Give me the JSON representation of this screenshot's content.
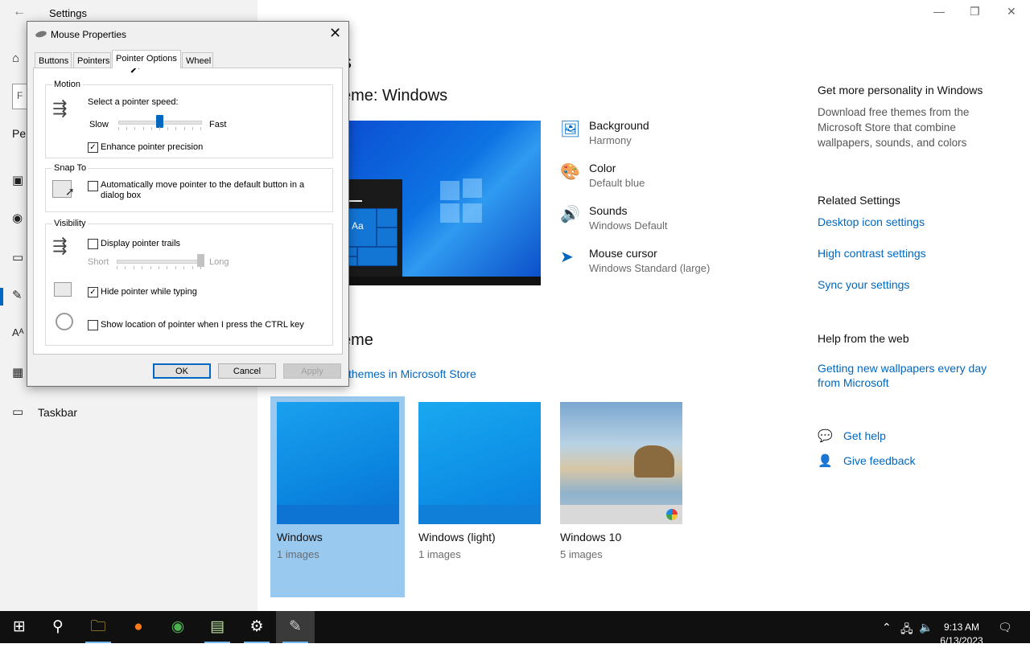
{
  "settings": {
    "title": "Settings",
    "nav": {
      "section_partial": "Per",
      "taskbar_label": "Taskbar",
      "search_partial": "F"
    },
    "main": {
      "heading_partial": "s",
      "current_theme_partial": "eme: Windows",
      "change_theme_partial": "eme",
      "store_link_partial": "themes in Microsoft Store"
    },
    "customize": [
      {
        "label": "Background",
        "sub": "Harmony",
        "icon": "picture-icon"
      },
      {
        "label": "Color",
        "sub": "Default blue",
        "icon": "palette-icon"
      },
      {
        "label": "Sounds",
        "sub": "Windows Default",
        "icon": "speaker-icon"
      },
      {
        "label": "Mouse cursor",
        "sub": "Windows Standard (large)",
        "icon": "cursor-icon"
      }
    ],
    "sidebar": {
      "personality_heading": "Get more personality in Windows",
      "personality_text": "Download free themes from the Microsoft Store that combine wallpapers, sounds, and colors",
      "related_heading": "Related Settings",
      "related_links": [
        "Desktop icon settings",
        "High contrast settings",
        "Sync your settings"
      ],
      "help_heading": "Help from the web",
      "help_link": "Getting new wallpapers every day from Microsoft",
      "get_help": "Get help",
      "give_feedback": "Give feedback"
    },
    "preview_tile_label": "Aa",
    "themes": [
      {
        "name": "Windows",
        "count": "1 images",
        "selected": true
      },
      {
        "name": "Windows (light)",
        "count": "1 images",
        "selected": false
      },
      {
        "name": "Windows 10",
        "count": "5 images",
        "selected": false
      }
    ]
  },
  "dialog": {
    "title": "Mouse Properties",
    "tabs": [
      "Buttons",
      "Pointers",
      "Pointer Options",
      "Wheel"
    ],
    "active_tab": "Pointer Options",
    "motion": {
      "label": "Motion",
      "speed_label": "Select a pointer speed:",
      "slow": "Slow",
      "fast": "Fast",
      "speed_value": 0.5,
      "precision_label": "Enhance pointer precision",
      "precision_checked": true
    },
    "snap": {
      "label": "Snap To",
      "text": "Automatically move pointer to the default button in a dialog box",
      "checked": false
    },
    "visibility": {
      "label": "Visibility",
      "trails_label": "Display pointer trails",
      "trails_checked": false,
      "short": "Short",
      "long": "Long",
      "trails_value": 1.0,
      "hide_label": "Hide pointer while typing",
      "hide_checked": true,
      "ctrl_label": "Show location of pointer when I press the CTRL key",
      "ctrl_checked": false
    },
    "buttons": {
      "ok": "OK",
      "cancel": "Cancel",
      "apply": "Apply"
    }
  },
  "taskbar": {
    "time": "9:13 AM",
    "date": "6/13/2023"
  },
  "colors": {
    "accent": "#0067c0",
    "selection": "#99c9ef"
  }
}
